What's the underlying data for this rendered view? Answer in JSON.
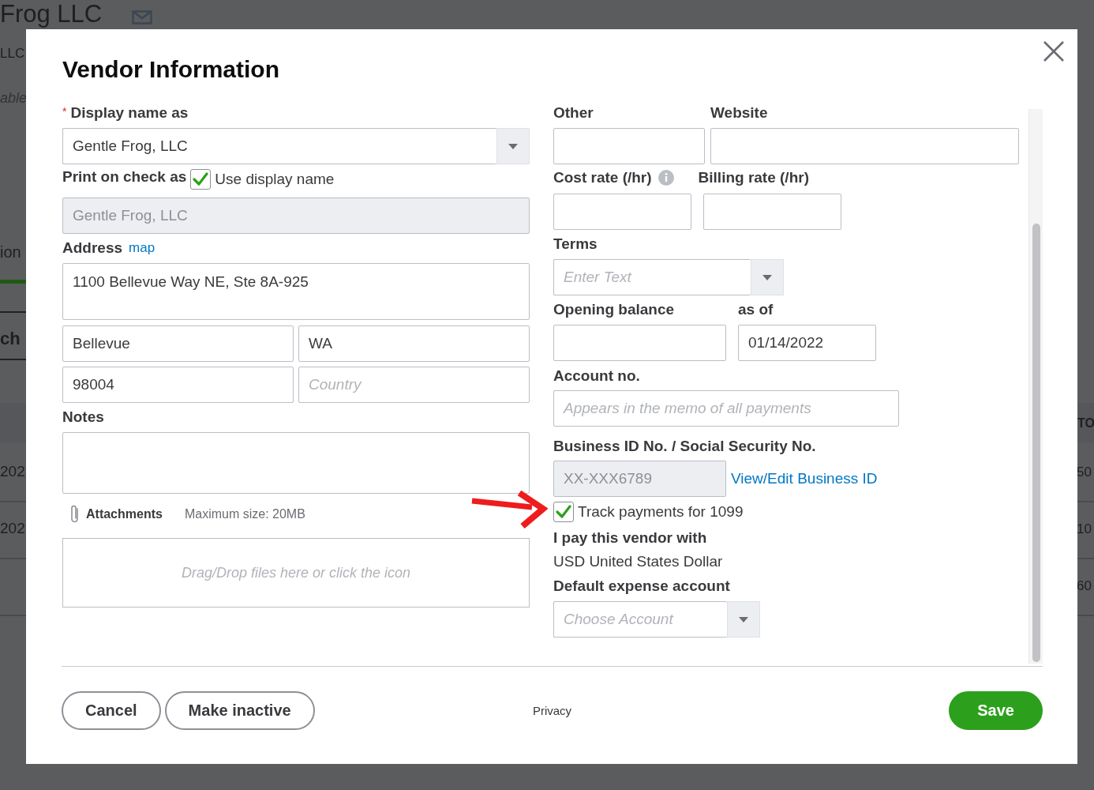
{
  "background": {
    "title": "Frog LLC",
    "subtitle": "LLC",
    "note": "able",
    "tab": "ion",
    "search": "ch",
    "table": {
      "header": "TO",
      "rows": [
        {
          "date": "202",
          "total": "50"
        },
        {
          "date": "202",
          "total": "10"
        },
        {
          "total": "60"
        }
      ]
    }
  },
  "dialog": {
    "title": "Vendor Information"
  },
  "display_name": {
    "required_mark": "*",
    "label": "Display name as",
    "value": "Gentle Frog, LLC"
  },
  "print_on_check": {
    "label": "Print on check as",
    "checkbox_label": "Use display name",
    "checked": true,
    "value": "Gentle Frog, LLC",
    "disabled": true
  },
  "address": {
    "label": "Address",
    "link": "map",
    "street": "1100 Bellevue Way NE, Ste 8A-925",
    "fields": [
      {
        "value": "Bellevue"
      },
      {
        "value": "WA"
      },
      {
        "value": "98004"
      },
      {
        "placeholder": "Country"
      }
    ]
  },
  "notes": {
    "label": "Notes"
  },
  "attachments": {
    "label": "Attachments",
    "max_size": "Maximum size: 20MB",
    "dropzone": {
      "placeholder": "Drag/Drop files here or click the icon"
    }
  },
  "other": {
    "label": "Other"
  },
  "website": {
    "label": "Website"
  },
  "cost_rate": {
    "label": "Cost rate (/hr)"
  },
  "billing_rate": {
    "label": "Billing rate (/hr)"
  },
  "terms": {
    "label": "Terms",
    "placeholder": "Enter Text"
  },
  "opening_balance": {
    "label": "Opening balance"
  },
  "as_of": {
    "label": "as of",
    "value": "01/14/2022"
  },
  "account_no": {
    "label": "Account no.",
    "placeholder": "Appears in the memo of all payments"
  },
  "business_id": {
    "label": "Business ID No. / Social Security No.",
    "value": "XX-XXX6789",
    "disabled": true,
    "link": "View/Edit Business ID"
  },
  "track_1099": {
    "label": "Track payments for 1099",
    "checked": true
  },
  "currency": {
    "label": "I pay this vendor with",
    "value": "USD United States Dollar"
  },
  "expense_account": {
    "label": "Default expense account",
    "placeholder": "Choose Account"
  },
  "footer": {
    "buttons": [
      {
        "label": "Cancel"
      },
      {
        "label": "Make inactive"
      }
    ],
    "privacy": "Privacy",
    "save": {
      "label": "Save"
    }
  }
}
